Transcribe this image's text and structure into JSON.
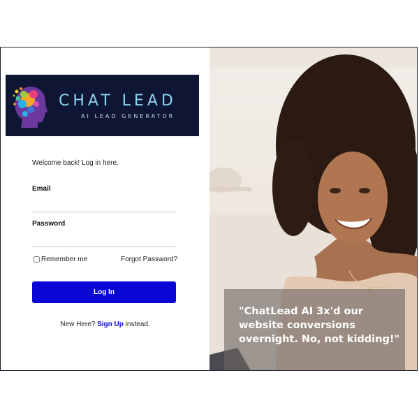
{
  "brand": {
    "title": "CHAT LEAD",
    "subtitle": "AI LEAD GENERATOR",
    "banner_color": "#0e1633",
    "title_color": "#8ad3f0"
  },
  "login": {
    "welcome": "Welcome back! Log in here.",
    "email_label": "Email",
    "email_value": "",
    "password_label": "Password",
    "password_value": "",
    "remember_label": "Remember me",
    "remember_checked": false,
    "forgot_label": "Forgot Password?",
    "login_button": "Log In",
    "button_color": "#0a06d6",
    "signup_prefix": "New Here?",
    "signup_link": "Sign Up",
    "signup_suffix": "instead."
  },
  "hero": {
    "quote": "\"ChatLead AI 3x'd our website conversions overnight. No, not kidding!\""
  }
}
